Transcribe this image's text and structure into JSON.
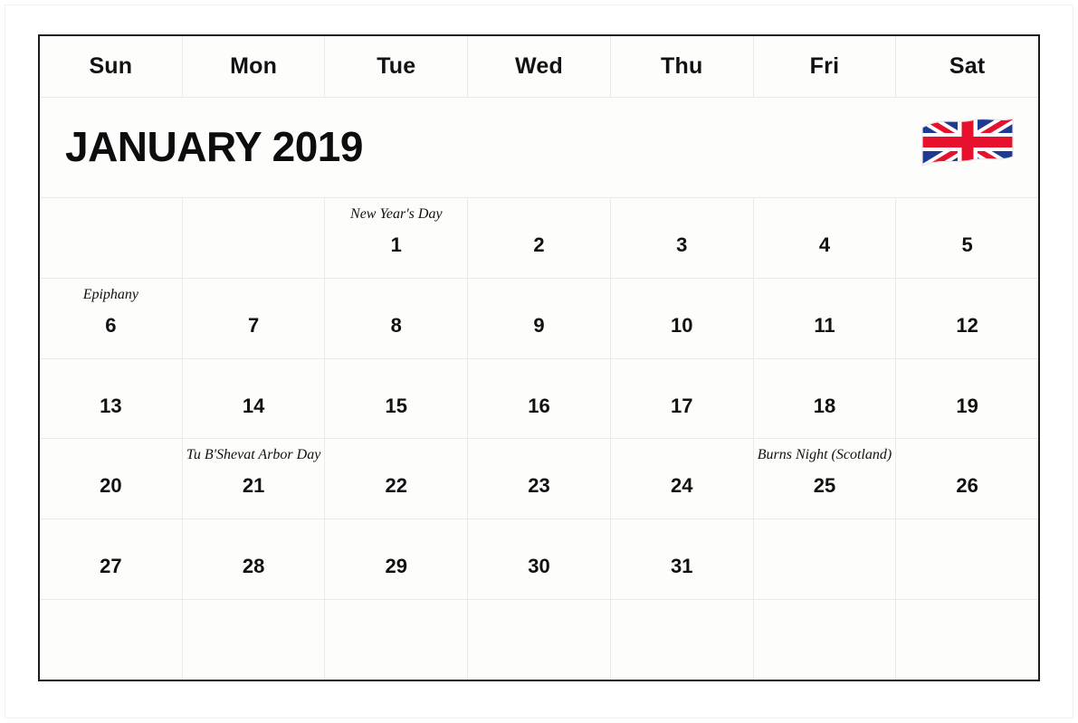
{
  "calendar": {
    "month_title": "JANUARY 2019",
    "flag": {
      "icon": "uk-flag-icon",
      "name": "Union Jack",
      "colors": {
        "blue": "#1f3a93",
        "red": "#e8112d",
        "white": "#ffffff"
      }
    },
    "weekdays": [
      "Sun",
      "Mon",
      "Tue",
      "Wed",
      "Thu",
      "Fri",
      "Sat"
    ],
    "weeks": [
      [
        {
          "day": "",
          "holiday": ""
        },
        {
          "day": "",
          "holiday": ""
        },
        {
          "day": "1",
          "holiday": "New Year's Day"
        },
        {
          "day": "2",
          "holiday": ""
        },
        {
          "day": "3",
          "holiday": ""
        },
        {
          "day": "4",
          "holiday": ""
        },
        {
          "day": "5",
          "holiday": ""
        }
      ],
      [
        {
          "day": "6",
          "holiday": "Epiphany"
        },
        {
          "day": "7",
          "holiday": ""
        },
        {
          "day": "8",
          "holiday": ""
        },
        {
          "day": "9",
          "holiday": ""
        },
        {
          "day": "10",
          "holiday": ""
        },
        {
          "day": "11",
          "holiday": ""
        },
        {
          "day": "12",
          "holiday": ""
        }
      ],
      [
        {
          "day": "13",
          "holiday": ""
        },
        {
          "day": "14",
          "holiday": ""
        },
        {
          "day": "15",
          "holiday": ""
        },
        {
          "day": "16",
          "holiday": ""
        },
        {
          "day": "17",
          "holiday": ""
        },
        {
          "day": "18",
          "holiday": ""
        },
        {
          "day": "19",
          "holiday": ""
        }
      ],
      [
        {
          "day": "20",
          "holiday": ""
        },
        {
          "day": "21",
          "holiday": "Tu B'Shevat Arbor Day"
        },
        {
          "day": "22",
          "holiday": ""
        },
        {
          "day": "23",
          "holiday": ""
        },
        {
          "day": "24",
          "holiday": ""
        },
        {
          "day": "25",
          "holiday": "Burns Night (Scotland)"
        },
        {
          "day": "26",
          "holiday": ""
        }
      ],
      [
        {
          "day": "27",
          "holiday": ""
        },
        {
          "day": "28",
          "holiday": ""
        },
        {
          "day": "29",
          "holiday": ""
        },
        {
          "day": "30",
          "holiday": ""
        },
        {
          "day": "31",
          "holiday": ""
        },
        {
          "day": "",
          "holiday": ""
        },
        {
          "day": "",
          "holiday": ""
        }
      ],
      [
        {
          "day": "",
          "holiday": ""
        },
        {
          "day": "",
          "holiday": ""
        },
        {
          "day": "",
          "holiday": ""
        },
        {
          "day": "",
          "holiday": ""
        },
        {
          "day": "",
          "holiday": ""
        },
        {
          "day": "",
          "holiday": ""
        },
        {
          "day": "",
          "holiday": ""
        }
      ]
    ]
  }
}
